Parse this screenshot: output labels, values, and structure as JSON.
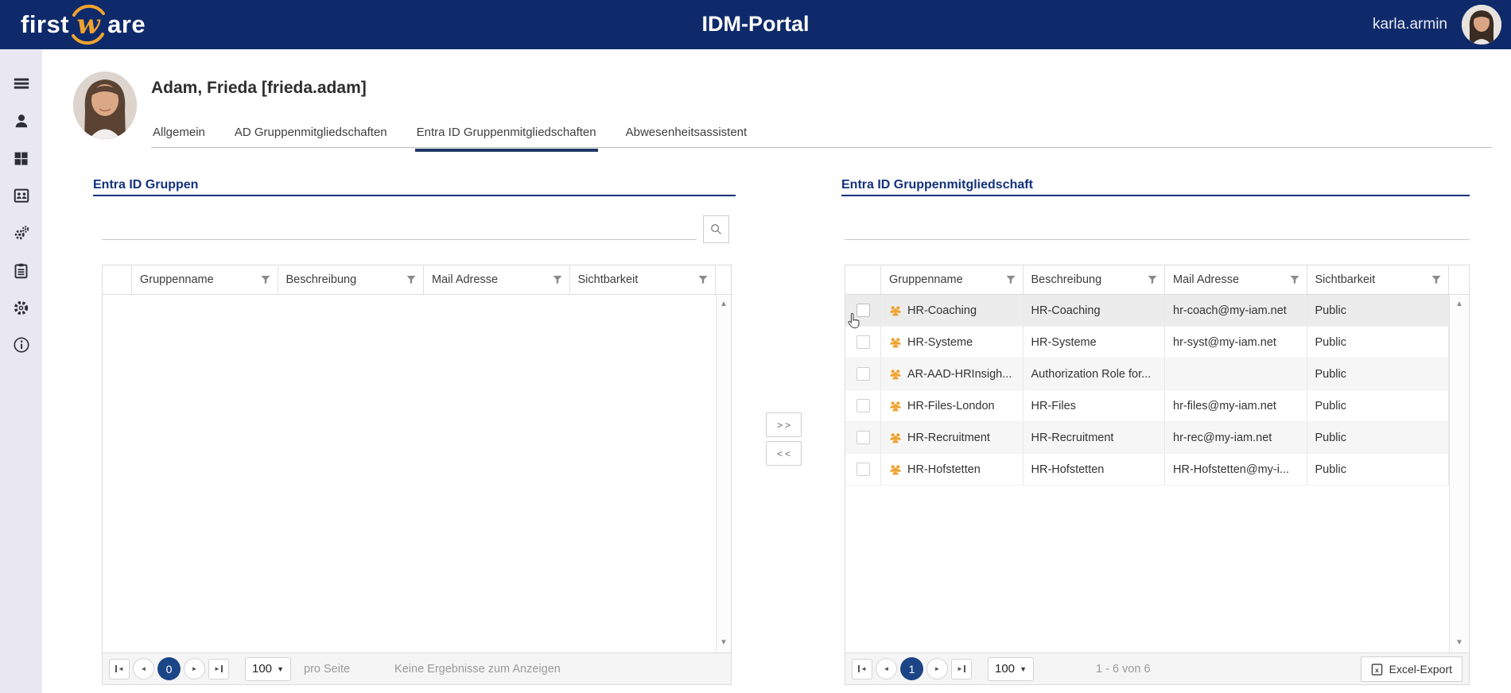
{
  "header": {
    "logo": {
      "text_first": "first",
      "text_w": "w",
      "text_are": "are"
    },
    "title": "IDM-Portal",
    "username": "karla.armin"
  },
  "sidebar": {
    "items": [
      {
        "name": "menu"
      },
      {
        "name": "user"
      },
      {
        "name": "dashboard"
      },
      {
        "name": "contacts"
      },
      {
        "name": "services"
      },
      {
        "name": "tasks"
      },
      {
        "name": "settings"
      },
      {
        "name": "info"
      }
    ]
  },
  "profile": {
    "display_name": "Adam, Frieda [frieda.adam]"
  },
  "tabs": [
    {
      "label": "Allgemein"
    },
    {
      "label": "AD Gruppenmitgliedschaften"
    },
    {
      "label": "Entra ID Gruppenmitgliedschaften",
      "state": "active"
    },
    {
      "label": "Abwesenheitsassistent"
    }
  ],
  "transfer": {
    "add_label": ">>",
    "remove_label": "<<"
  },
  "left_panel": {
    "title": "Entra ID Gruppen",
    "search_value": "",
    "table": {
      "columns": [
        {
          "label": "Gruppenname"
        },
        {
          "label": "Beschreibung"
        },
        {
          "label": "Mail Adresse"
        },
        {
          "label": "Sichtbarkeit"
        }
      ],
      "rows": []
    },
    "pagination": {
      "page": "0",
      "page_size": "100",
      "per_page_label": "pro Seite",
      "status": "Keine Ergebnisse zum Anzeigen"
    }
  },
  "right_panel": {
    "title": "Entra ID Gruppenmitgliedschaft",
    "table": {
      "columns": [
        {
          "label": "Gruppenname"
        },
        {
          "label": "Beschreibung"
        },
        {
          "label": "Mail Adresse"
        },
        {
          "label": "Sichtbarkeit"
        }
      ],
      "rows": [
        {
          "name": "HR-Coaching",
          "description": "HR-Coaching",
          "mail": "hr-coach@my-iam.net",
          "visibility": "Public",
          "state": "hovered"
        },
        {
          "name": "HR-Systeme",
          "description": "HR-Systeme",
          "mail": "hr-syst@my-iam.net",
          "visibility": "Public"
        },
        {
          "name": "AR-AAD-HRInsigh...",
          "description": "Authorization Role for...",
          "mail": "",
          "visibility": "Public"
        },
        {
          "name": "HR-Files-London",
          "description": "HR-Files",
          "mail": "hr-files@my-iam.net",
          "visibility": "Public"
        },
        {
          "name": "HR-Recruitment",
          "description": "HR-Recruitment",
          "mail": "hr-rec@my-iam.net",
          "visibility": "Public"
        },
        {
          "name": "HR-Hofstetten",
          "description": "HR-Hofstetten",
          "mail": "HR-Hofstetten@my-i...",
          "visibility": "Public"
        }
      ]
    },
    "pagination": {
      "page": "1",
      "page_size": "100",
      "status": "1 - 6 von 6",
      "export_label": "Excel-Export"
    }
  },
  "colors": {
    "header_navy": "#0f2a6b",
    "heading_navy": "#13317c",
    "active_page_circle": "#1c4587",
    "group_icon_orange": "#efa32e",
    "sidebar_bg": "#e9e8f2"
  }
}
